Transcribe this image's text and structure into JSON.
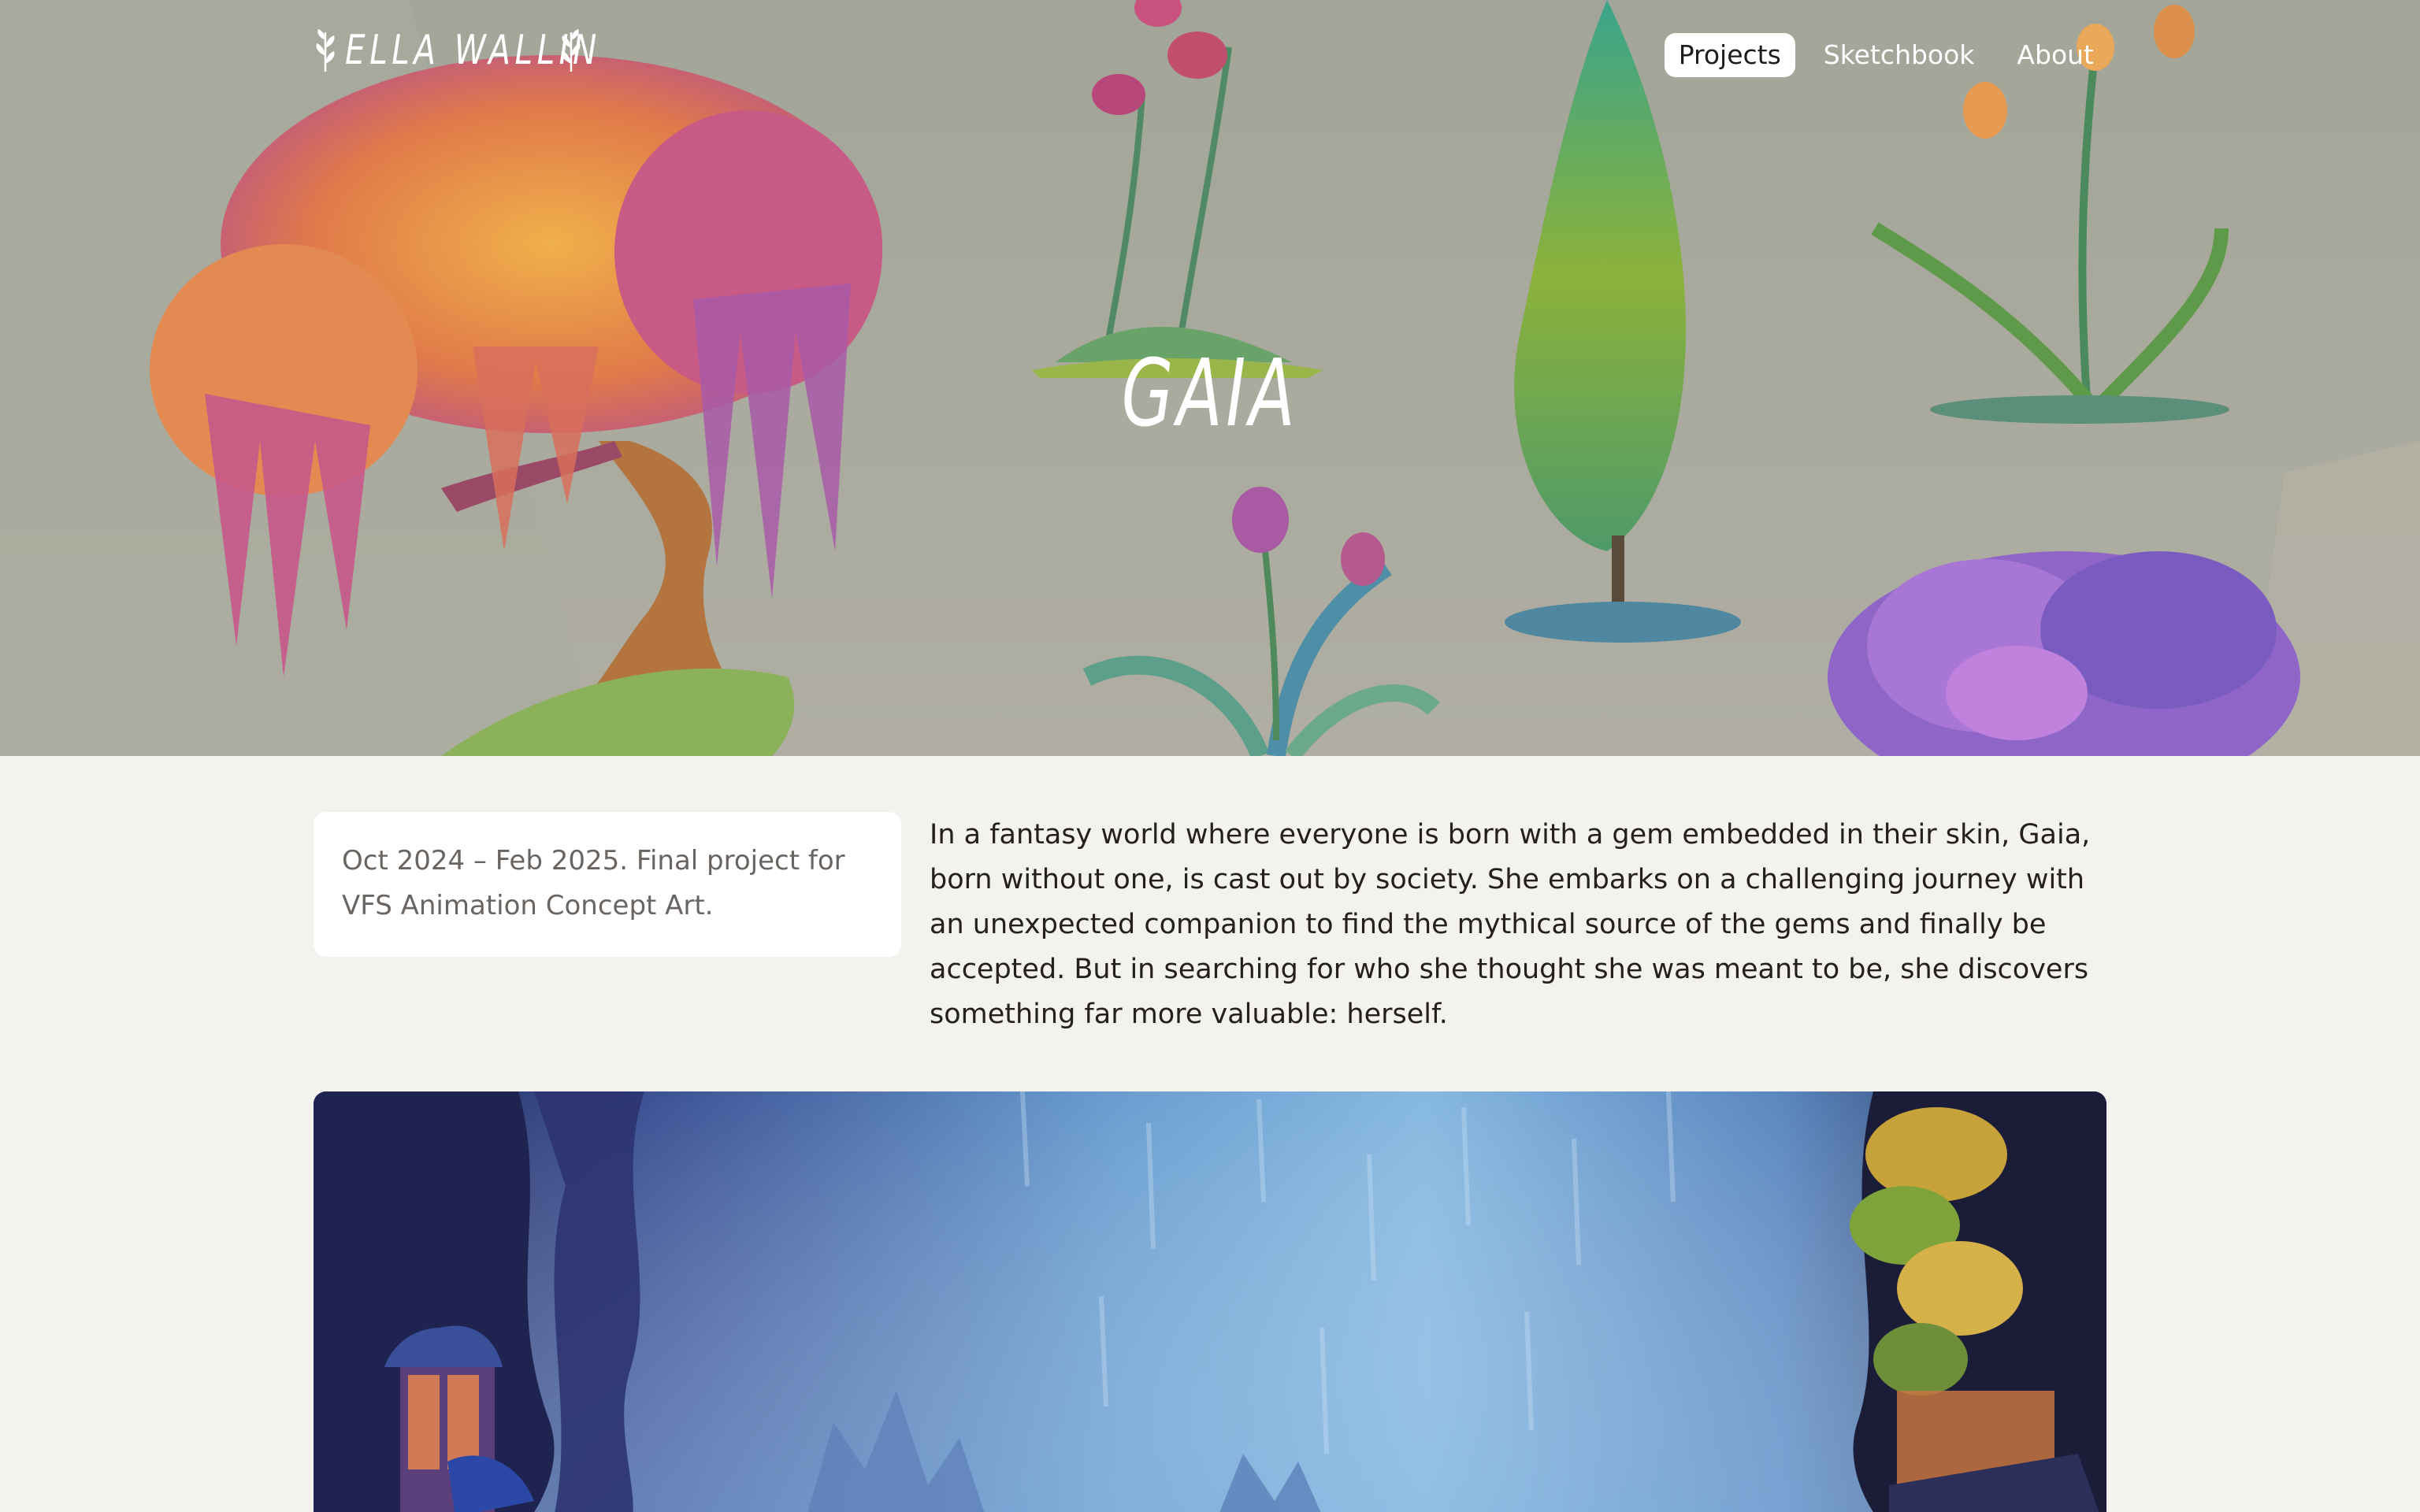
{
  "site": {
    "logo_text": "ELLA WALLIN",
    "nav": [
      {
        "label": "Projects",
        "active": true
      },
      {
        "label": "Sketchbook",
        "active": false
      },
      {
        "label": "About",
        "active": false
      }
    ]
  },
  "hero": {
    "title": "GAIA"
  },
  "project": {
    "meta": "Oct 2024 – Feb 2025. Final project for VFS Animation Concept Art.",
    "description": "In a fantasy world where everyone is born with a gem embedded in their skin, Gaia, born without one, is cast out by society. She embarks on a challenging journey with an unexpected companion to find the mythical source of the gems and finally be accepted. But in searching for who she thought she was meant to be, she discovers something far more valuable: herself."
  },
  "colors": {
    "page_background": "#f4f2ee",
    "hero_background": "#a5a69b",
    "card_background": "#ffffff",
    "nav_active_background": "#ffffff"
  },
  "icons": {
    "logo_ornament": "leaf-sprig-icon"
  }
}
